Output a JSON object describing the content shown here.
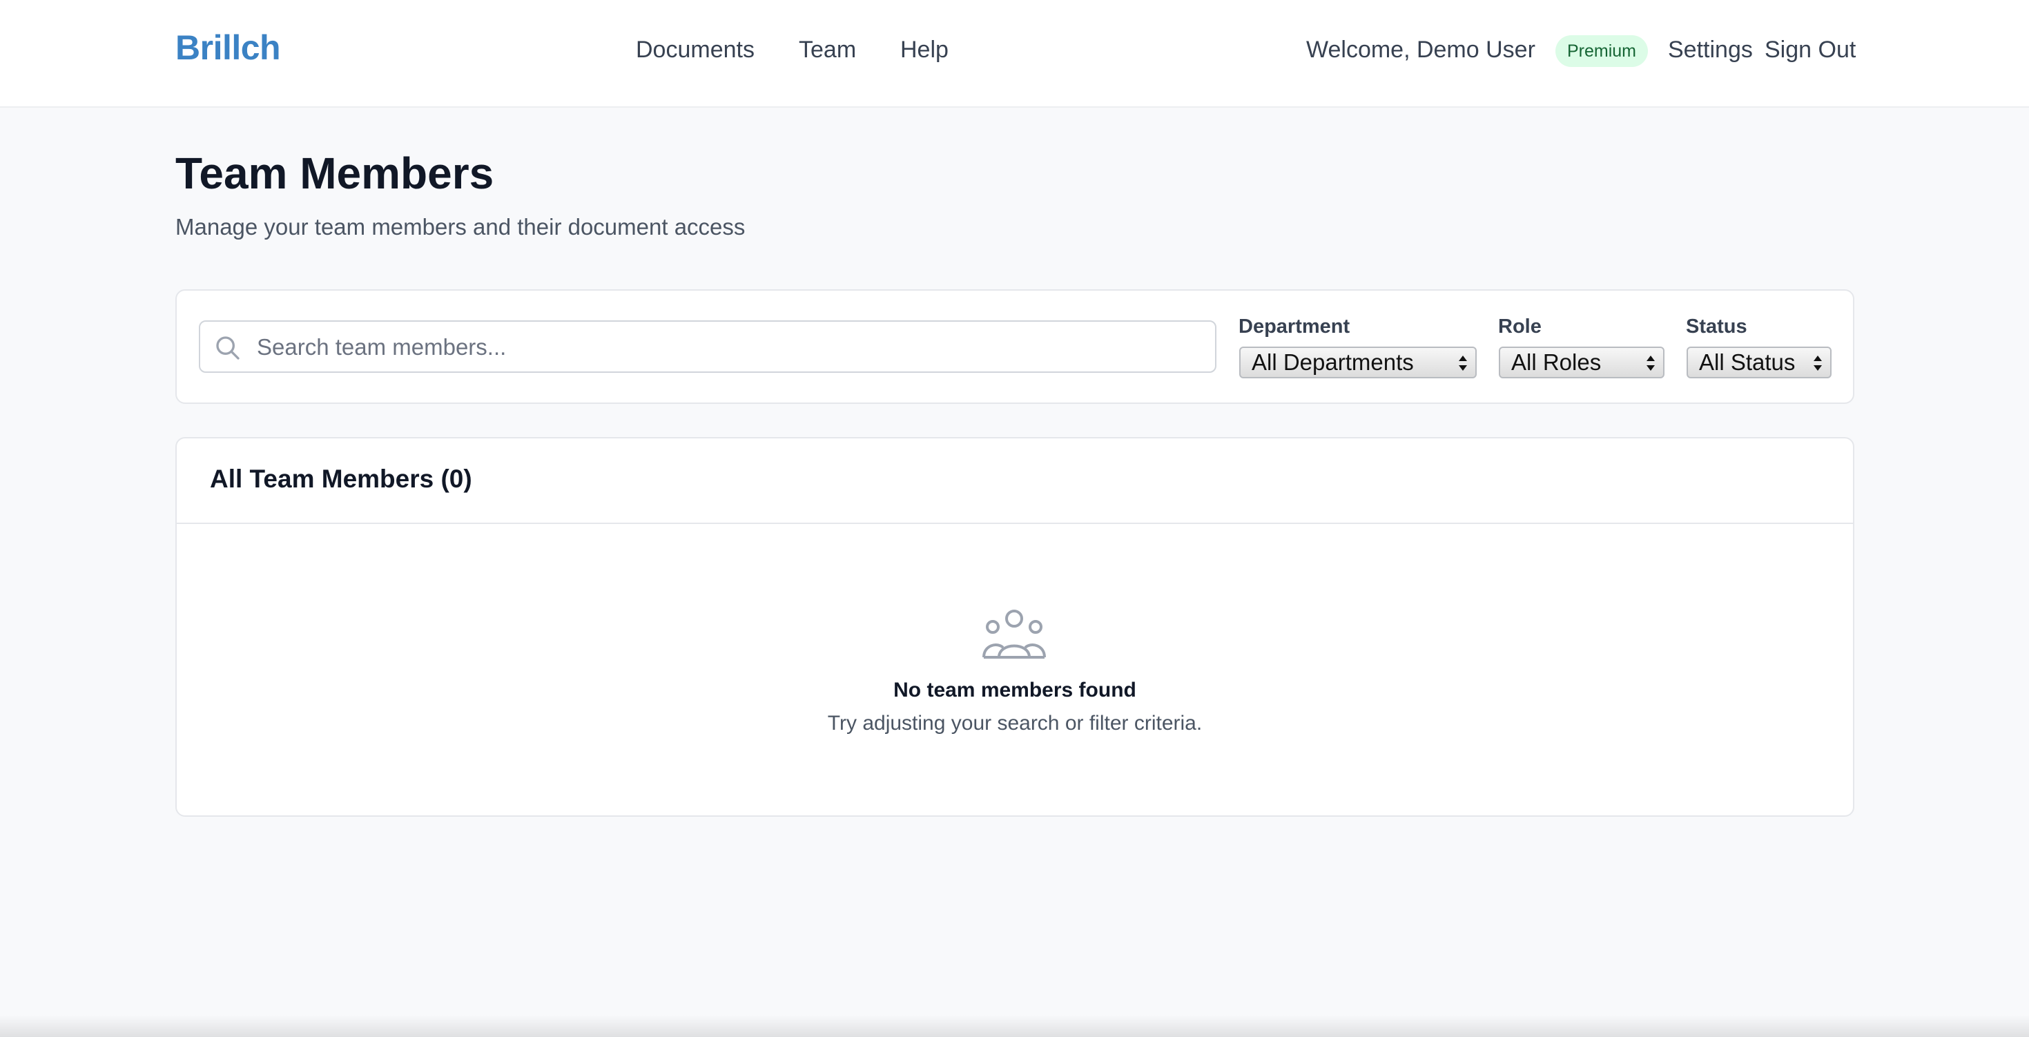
{
  "header": {
    "brand": "Brillch",
    "nav": [
      {
        "label": "Documents"
      },
      {
        "label": "Team"
      },
      {
        "label": "Help"
      }
    ],
    "welcome": "Welcome, Demo User",
    "badge": "Premium",
    "settings": "Settings",
    "sign_out": "Sign Out"
  },
  "page": {
    "title": "Team Members",
    "subtitle": "Manage your team members and their document access"
  },
  "filters": {
    "search_placeholder": "Search team members...",
    "search_value": "",
    "department": {
      "label": "Department",
      "selected": "All Departments"
    },
    "role": {
      "label": "Role",
      "selected": "All Roles"
    },
    "status": {
      "label": "Status",
      "selected": "All Status"
    }
  },
  "list": {
    "title": "All Team Members (0)",
    "empty_title": "No team members found",
    "empty_subtitle": "Try adjusting your search or filter criteria.",
    "empty_icon": "users-group-icon"
  },
  "colors": {
    "brand": "#3b82c4",
    "badge_bg": "#dcfce7",
    "badge_text": "#166534",
    "page_bg": "#f8f9fb"
  }
}
